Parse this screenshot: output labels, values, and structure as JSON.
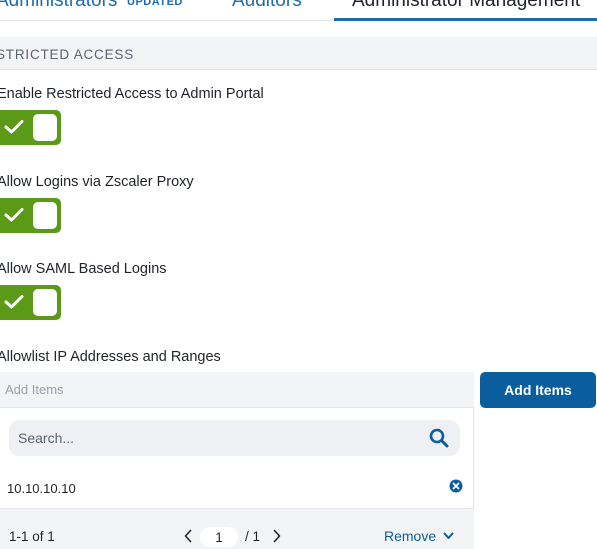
{
  "tabs": [
    {
      "label": "Administrators",
      "badge": "UPDATED"
    },
    {
      "label": "Auditors"
    },
    {
      "label": "Administrator Management",
      "active": true
    }
  ],
  "section": {
    "title": "STRICTED ACCESS"
  },
  "settings": [
    {
      "label": "Enable Restricted Access to Admin Portal",
      "enabled": true
    },
    {
      "label": "Allow Logins via Zscaler Proxy",
      "enabled": true
    },
    {
      "label": "Allow SAML Based Logins",
      "enabled": true
    }
  ],
  "allowlist": {
    "label": "Allowlist IP Addresses and Ranges",
    "add_placeholder": "Add Items",
    "add_button": "Add Items",
    "search_placeholder": "Search...",
    "items": [
      "10.10.10.10"
    ],
    "pager": {
      "count": "1-1 of 1",
      "page": "1",
      "total": "/ 1"
    },
    "remove_label": "Remove"
  },
  "colors": {
    "accent": "#1e6cb0",
    "primary_button": "#0b5e9e",
    "toggle_on": "#5a9a16"
  },
  "icons": {
    "toggle": "check-icon",
    "search": "search-icon",
    "remove_item": "close-circle-icon",
    "prev": "chevron-left-icon",
    "next": "chevron-right-icon",
    "menu": "chevron-down-icon"
  }
}
